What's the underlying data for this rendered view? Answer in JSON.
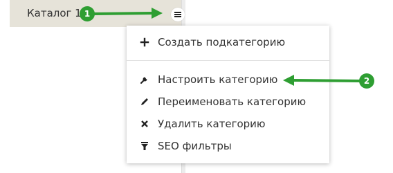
{
  "tree": {
    "catalog_label": "Каталог 1"
  },
  "context_menu": {
    "items": [
      {
        "label": "Создать подкатегорию",
        "icon": "plus-icon"
      },
      {
        "label": "Настроить категорию",
        "icon": "wrench-icon"
      },
      {
        "label": "Переименовать категорию",
        "icon": "pencil-icon"
      },
      {
        "label": "Удалить категорию",
        "icon": "cross-icon"
      },
      {
        "label": "SEO фильтры",
        "icon": "filter-icon"
      }
    ]
  },
  "annotations": {
    "step1": "1",
    "step2": "2",
    "color": "#2e9e32"
  },
  "colors": {
    "catalog_row_bg": "#e6e3d9",
    "menu_bg": "#ffffff",
    "text": "#333333"
  }
}
